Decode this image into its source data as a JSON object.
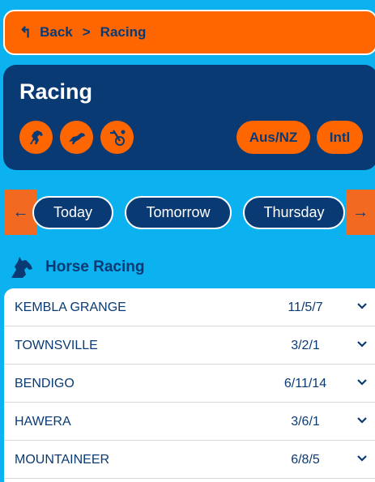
{
  "breadcrumb": {
    "back_label": "Back",
    "separator": ">",
    "current": "Racing"
  },
  "header": {
    "title": "Racing",
    "race_types": [
      "horse-racing-icon",
      "greyhound-icon",
      "harness-icon"
    ],
    "regions": [
      "Aus/NZ",
      "Intl"
    ]
  },
  "days": [
    "Today",
    "Tomorrow",
    "Thursday"
  ],
  "section": {
    "title": "Horse Racing"
  },
  "meetings": [
    {
      "name": "KEMBLA GRANGE",
      "count": "11/5/7"
    },
    {
      "name": "TOWNSVILLE",
      "count": "3/2/1"
    },
    {
      "name": "BENDIGO",
      "count": "6/11/14"
    },
    {
      "name": "HAWERA",
      "count": "3/6/1"
    },
    {
      "name": "MOUNTAINEER",
      "count": "6/8/5"
    }
  ],
  "colors": {
    "navy": "#0a3a73",
    "orange": "#ff6600",
    "background": "#0bb2ef"
  }
}
